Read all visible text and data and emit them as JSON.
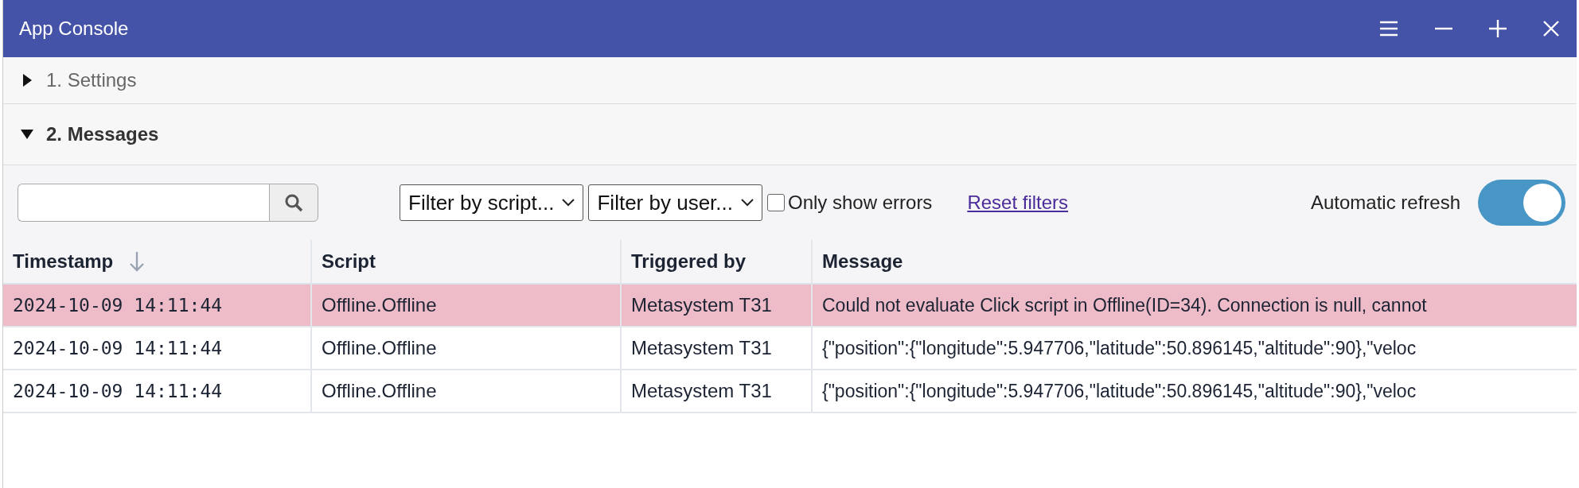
{
  "window": {
    "title": "App Console"
  },
  "sections": [
    {
      "label": "1. Settings",
      "expanded": false
    },
    {
      "label": "2. Messages",
      "expanded": true
    }
  ],
  "toolbar": {
    "filters": [
      {
        "label": "Filter by script..."
      },
      {
        "label": "Filter by user..."
      }
    ],
    "only_errors": {
      "label": "Only show errors",
      "checked": false
    },
    "reset_link": "Reset filters",
    "auto_refresh": {
      "label": "Automatic refresh",
      "on": true
    }
  },
  "table": {
    "columns": [
      {
        "label": "Timestamp",
        "sorted": true
      },
      {
        "label": "Script",
        "sorted": false
      },
      {
        "label": "Triggered by",
        "sorted": false
      },
      {
        "label": "Message",
        "sorted": false
      }
    ],
    "rows": [
      {
        "error": true,
        "cells": [
          "2024-10-09 14:11:44",
          "Offline.Offline",
          "Metasystem T31",
          "Could not evaluate Click script in Offline(ID=34). Connection is null, cannot"
        ]
      },
      {
        "error": false,
        "cells": [
          "2024-10-09 14:11:44",
          "Offline.Offline",
          "Metasystem T31",
          "{\"position\":{\"longitude\":5.947706,\"latitude\":50.896145,\"altitude\":90},\"veloc"
        ]
      },
      {
        "error": false,
        "cells": [
          "2024-10-09 14:11:44",
          "Offline.Offline",
          "Metasystem T31",
          "{\"position\":{\"longitude\":5.947706,\"latitude\":50.896145,\"altitude\":90},\"veloc"
        ]
      }
    ]
  }
}
